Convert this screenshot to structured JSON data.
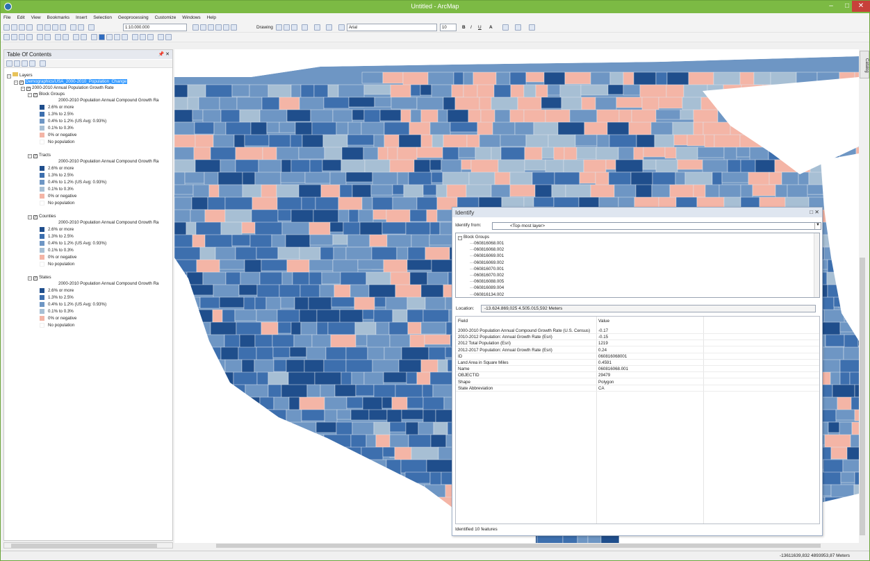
{
  "window": {
    "title": "Untitled - ArcMap"
  },
  "menu": [
    "File",
    "Edit",
    "View",
    "Bookmarks",
    "Insert",
    "Selection",
    "Geoprocessing",
    "Customize",
    "Windows",
    "Help"
  ],
  "toolbar": {
    "scale": "1:10.000.000",
    "drawing_label": "Drawing",
    "font": "Arial",
    "font_size": "10",
    "bold": "B",
    "italic": "I",
    "underline": "U",
    "font_color_glyph": "A"
  },
  "toc": {
    "title": "Table Of Contents",
    "root": "Layers",
    "layer": "Demographics/USA_2000-2010_Population_Change",
    "group": "2000-2010 Annual Population Growth Rate",
    "sublayers": [
      {
        "name": "Block Groups",
        "heading": "2000-2010 Population Annual Compound Growth Ra"
      },
      {
        "name": "Tracts",
        "heading": "2000-2010 Population Annual Compound Growth Ra"
      },
      {
        "name": "Counties",
        "heading": "2000-2010 Population Annual Compound Growth Ra"
      },
      {
        "name": "States",
        "heading": "2000-2010 Population Annual Compound Growth Ra"
      }
    ],
    "legend": [
      {
        "label": "2.6% or more",
        "color": "#1f4e8c"
      },
      {
        "label": "1.3% to 2.5%",
        "color": "#3d6fae"
      },
      {
        "label": "0.4% to 1.2% (US Avg: 0.93%)",
        "color": "#6e96c4"
      },
      {
        "label": "0.1% to 0.3%",
        "color": "#a7bfd4"
      },
      {
        "label": "0% or negative",
        "color": "#f4b5a6"
      },
      {
        "label": "No population",
        "color": "#ffffff"
      }
    ]
  },
  "identify": {
    "title": "Identify",
    "from_label": "Identify from:",
    "from_value": "<Top-most layer>",
    "tree_root": "Block Groups",
    "tree_items": [
      "060816068.001",
      "060816068.002",
      "060816069.001",
      "060816069.002",
      "060816070.001",
      "060816070.002",
      "060816088.005",
      "060816089.004",
      "060816134.002"
    ],
    "location_label": "Location:",
    "location": "-13.624.869,025  4.505.015,592 Meters",
    "columns": [
      "Field",
      "Value"
    ],
    "rows": [
      {
        "field": "2000-2010 Population Annual Compound Growth Rate (U.S. Census)",
        "value": "-0.17"
      },
      {
        "field": "2010-2012 Population: Annual Growth Rate (Esri)",
        "value": "-0.15"
      },
      {
        "field": "2012 Total Population (Esri)",
        "value": "1219"
      },
      {
        "field": "2012-2017 Population: Annual Growth Rate (Esri)",
        "value": "0.24"
      },
      {
        "field": "ID",
        "value": "060816068001"
      },
      {
        "field": "Land Area in Square Miles",
        "value": "0.4591"
      },
      {
        "field": "Name",
        "value": "060816068.001"
      },
      {
        "field": "OBJECTID",
        "value": "29479"
      },
      {
        "field": "Shape",
        "value": "Polygon"
      },
      {
        "field": "State Abbreviation",
        "value": "CA"
      }
    ],
    "footer": "Identified 10 features"
  },
  "catalog_tab": "Catalog",
  "status": {
    "coordinates": "-13611639,832  4893953,87 Meters"
  }
}
